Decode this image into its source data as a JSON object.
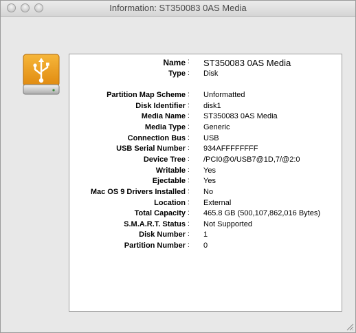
{
  "window": {
    "title": "Information: ST350083 0AS Media"
  },
  "header": {
    "name_label": "Name",
    "name_value": "ST350083 0AS Media",
    "type_label": "Type",
    "type_value": "Disk"
  },
  "details": [
    {
      "label": "Partition Map Scheme",
      "value": "Unformatted"
    },
    {
      "label": "Disk Identifier",
      "value": "disk1"
    },
    {
      "label": "Media Name",
      "value": "ST350083 0AS Media"
    },
    {
      "label": "Media Type",
      "value": "Generic"
    },
    {
      "label": "Connection Bus",
      "value": "USB"
    },
    {
      "label": "USB Serial Number",
      "value": "934AFFFFFFFF"
    },
    {
      "label": "Device Tree",
      "value": "/PCI0@0/USB7@1D,7/@2:0"
    },
    {
      "label": "Writable",
      "value": "Yes"
    },
    {
      "label": "Ejectable",
      "value": "Yes"
    },
    {
      "label": "Mac OS 9 Drivers Installed",
      "value": "No"
    },
    {
      "label": "Location",
      "value": "External"
    },
    {
      "label": "Total Capacity",
      "value": "465.8 GB (500,107,862,016 Bytes)"
    },
    {
      "label": "S.M.A.R.T. Status",
      "value": "Not Supported"
    },
    {
      "label": "Disk Number",
      "value": "1"
    },
    {
      "label": "Partition Number",
      "value": "0"
    }
  ],
  "separator": ":",
  "icons": {
    "drive": "usb-drive-icon",
    "resize": "resize-grip-icon"
  },
  "colors": {
    "drive_orange": "#f0a020",
    "panel_bg": "#ffffff",
    "window_bg": "#e8e8e8"
  }
}
